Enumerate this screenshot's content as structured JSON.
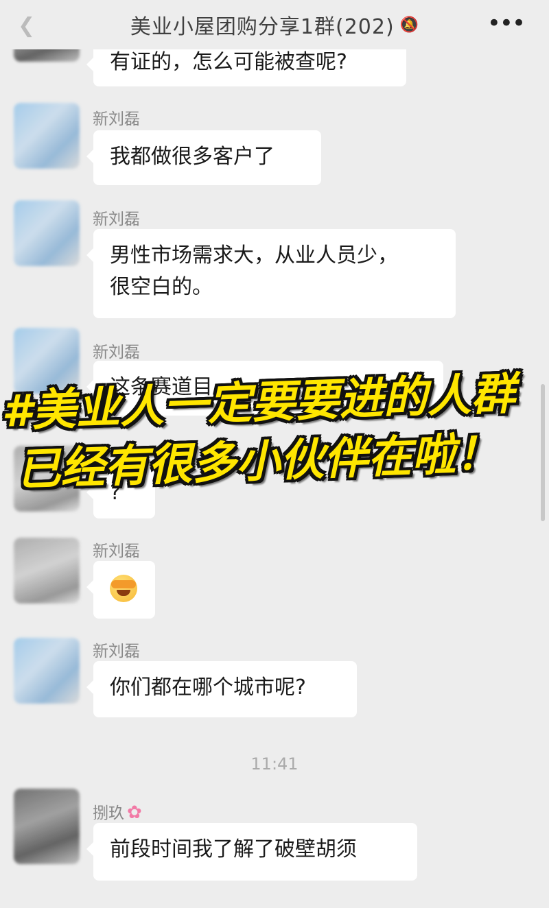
{
  "header": {
    "title": "美业小屋团购分享1群(202)",
    "mute_icon": "bell-off-icon",
    "more_icon": "ellipsis-icon",
    "back_icon": "chevron-left-icon"
  },
  "messages": [
    {
      "sender": "",
      "text": "有证的，怎么可能被查呢?"
    },
    {
      "sender": "新刘磊",
      "text": "我都做很多客户了"
    },
    {
      "sender": "新刘磊",
      "text_line1": "男性市场需求大，从业人员少，",
      "text_line2": "很空白的。"
    },
    {
      "sender": "新刘磊",
      "text": "这条赛道目"
    },
    {
      "sender": "",
      "text": "?"
    },
    {
      "sender": "新刘磊",
      "emoji": "crying-face-emoji"
    },
    {
      "sender": "新刘磊",
      "text": "你们都在哪个城市呢?"
    },
    {
      "sender": "捌玖",
      "text": "前段时间我了解了破壁胡须",
      "sender_icon": "flower-emoji"
    }
  ],
  "timestamp": "11:41",
  "overlay": {
    "line1": "#美业人一定要要进的人群",
    "line2": "已经有很多小伙伴在啦！",
    "color": "#ffe600"
  }
}
